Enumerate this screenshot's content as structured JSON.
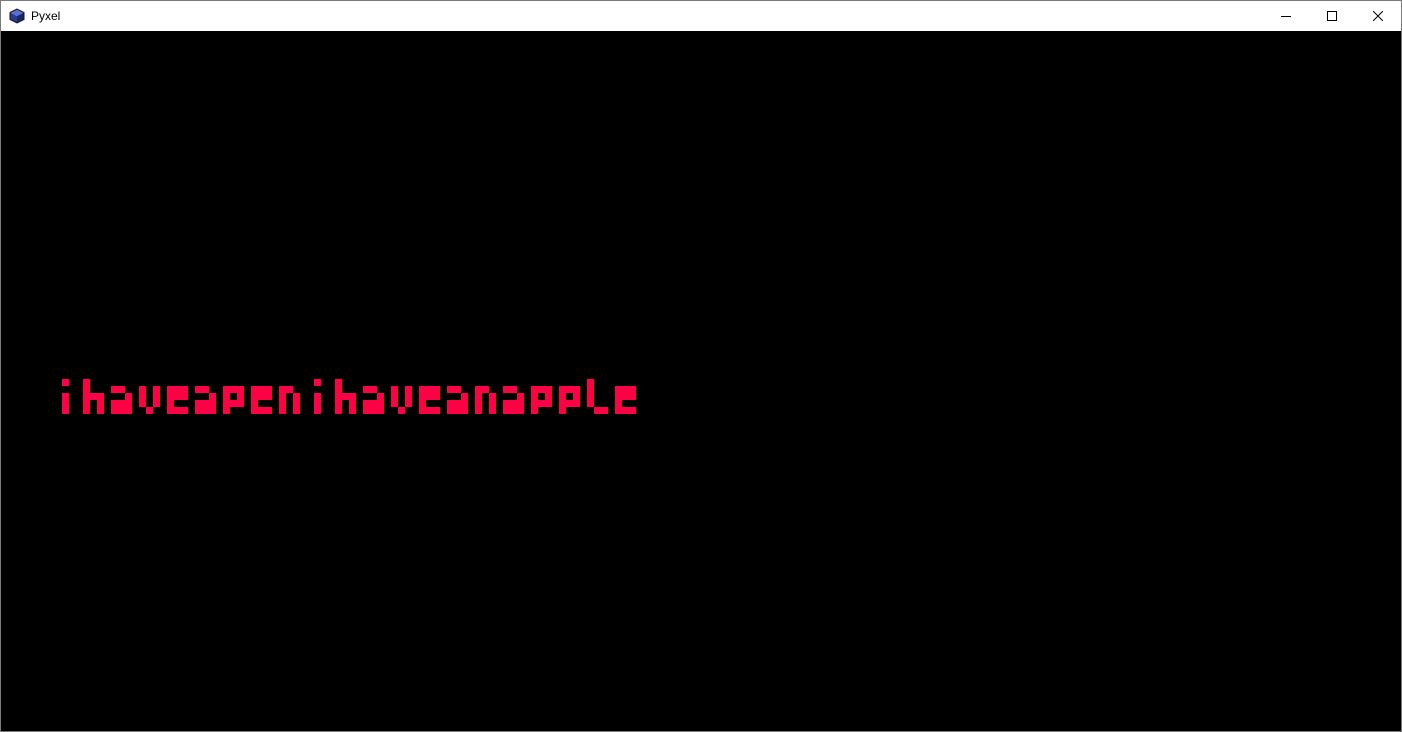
{
  "window": {
    "title": "Pyxel",
    "app_icon": "pyxel-cube-icon",
    "controls": {
      "minimize_icon": "minimize-icon",
      "maximize_icon": "maximize-icon",
      "close_icon": "close-icon"
    }
  },
  "screen": {
    "background_color": "#000000",
    "text": "ihaveapenihaveanapple",
    "text_color": "#ff0044"
  }
}
